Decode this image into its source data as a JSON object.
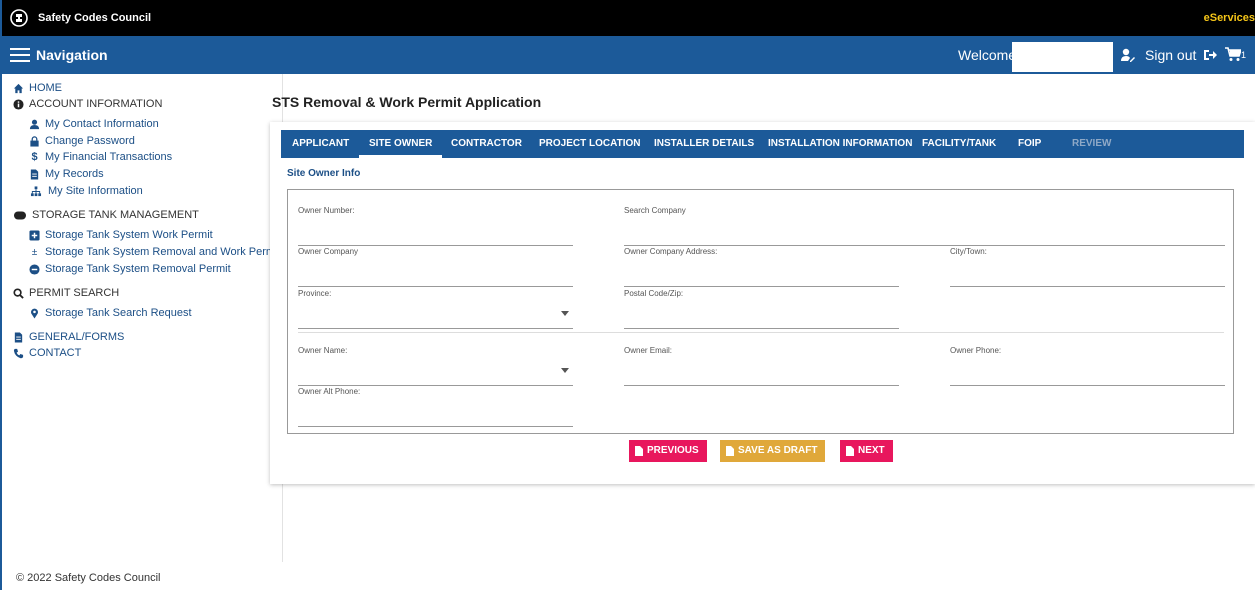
{
  "header": {
    "brand": "Safety Codes Council",
    "eservices": "eServices"
  },
  "navbar": {
    "title": "Navigation",
    "welcome": "Welcome,",
    "sign_out": "Sign out",
    "cart_count": "1"
  },
  "sidebar": {
    "home": "HOME",
    "account_heading": "ACCOUNT INFORMATION",
    "account_items": [
      "My Contact Information",
      "Change Password",
      "My Financial Transactions",
      "My Records",
      "My Site Information"
    ],
    "tank_heading": "STORAGE TANK MANAGEMENT",
    "tank_items": [
      "Storage Tank System Work Permit",
      "Storage Tank System Removal and Work Permi",
      "Storage Tank System Removal Permit"
    ],
    "permit_heading": "PERMIT SEARCH",
    "permit_items": [
      "Storage Tank Search Request"
    ],
    "general": "GENERAL/FORMS",
    "contact": "CONTACT"
  },
  "main": {
    "title": "STS Removal & Work Permit Application",
    "tabs": [
      "APPLICANT",
      "SITE OWNER",
      "CONTRACTOR",
      "PROJECT LOCATION",
      "INSTALLER DETAILS",
      "INSTALLATION INFORMATION",
      "FACILITY/TANK",
      "FOIP",
      "REVIEW"
    ],
    "active_tab": "SITE OWNER",
    "section_title": "Site Owner Info",
    "fields": {
      "owner_number": "Owner Number:",
      "search_company": "Search Company",
      "owner_company": "Owner Company",
      "owner_company_address": "Owner Company Address:",
      "city_town": "City/Town:",
      "province": "Province:",
      "postal_code": "Postal Code/Zip:",
      "owner_name": "Owner Name:",
      "owner_email": "Owner Email:",
      "owner_phone": "Owner Phone:",
      "owner_alt_phone": "Owner Alt Phone:"
    },
    "buttons": {
      "previous": "PREVIOUS",
      "save_draft": "SAVE AS DRAFT",
      "next": "NEXT"
    }
  },
  "footer": "© 2022 Safety Codes Council",
  "colors": {
    "primary": "#1c5a99",
    "link": "#1c4f86",
    "danger": "#e8175d",
    "warning": "#e0a83a",
    "eservices": "#f5c518"
  }
}
